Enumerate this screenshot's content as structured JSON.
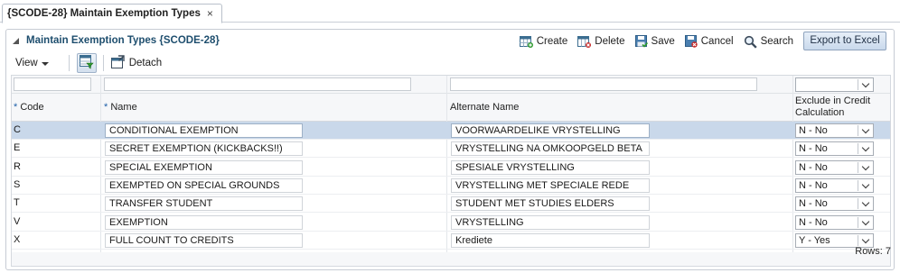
{
  "tab": {
    "title": "{SCODE-28} Maintain Exemption Types",
    "close_glyph": "×"
  },
  "panel": {
    "title": "Maintain Exemption Types {SCODE-28}"
  },
  "actions": {
    "create": "Create",
    "delete": "Delete",
    "save": "Save",
    "cancel": "Cancel",
    "search": "Search",
    "export": "Export to Excel"
  },
  "toolbar": {
    "view": "View",
    "detach": "Detach"
  },
  "columns": {
    "code": "Code",
    "name": "Name",
    "alternate": "Alternate Name",
    "exclude": "Exclude in Credit Calculation",
    "required_marker": "*"
  },
  "rows": [
    {
      "code": "C",
      "name": "CONDITIONAL EXEMPTION",
      "alt": "VOORWAARDELIKE VRYSTELLING",
      "exclude": "N - No",
      "selected": true
    },
    {
      "code": "E",
      "name": "SECRET EXEMPTION (KICKBACKS!!)",
      "alt": "VRYSTELLING NA OMKOOPGELD BETA",
      "exclude": "N - No"
    },
    {
      "code": "R",
      "name": "SPECIAL EXEMPTION",
      "alt": "SPESIALE VRYSTELLING",
      "exclude": "N - No"
    },
    {
      "code": "S",
      "name": "EXEMPTED ON SPECIAL GROUNDS",
      "alt": "VRYSTELLING MET SPECIALE REDE",
      "exclude": "N - No"
    },
    {
      "code": "T",
      "name": "TRANSFER STUDENT",
      "alt": "STUDENT MET STUDIES ELDERS",
      "exclude": "N - No"
    },
    {
      "code": "V",
      "name": "EXEMPTION",
      "alt": "VRYSTELLING",
      "exclude": "N - No"
    },
    {
      "code": "X",
      "name": "FULL COUNT TO CREDITS",
      "alt": "Krediete",
      "exclude": "Y - Yes"
    }
  ],
  "status": {
    "rows_label": "Rows: 7"
  },
  "colors": {
    "accent": "#1e4e6e",
    "selected_row": "#c9d8ea",
    "button": "#c9d9ec"
  }
}
